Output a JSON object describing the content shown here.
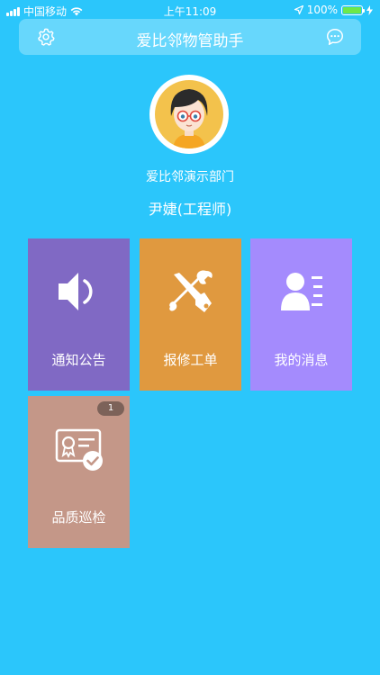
{
  "status_bar": {
    "carrier": "中国移动",
    "time": "上午11:09",
    "battery": "100%",
    "battery_level": 1.0,
    "battery_color": "#6ee84a"
  },
  "header": {
    "title": "爱比邻物管助手"
  },
  "profile": {
    "department": "爱比邻演示部门",
    "name": "尹婕(工程师)"
  },
  "tiles": [
    {
      "label": "通知公告",
      "icon": "speaker-icon",
      "color": "#8069c4"
    },
    {
      "label": "报修工单",
      "icon": "wrench-screwdriver-icon",
      "color": "#e0993f"
    },
    {
      "label": "我的消息",
      "icon": "contact-card-icon",
      "color": "#a48bfd"
    },
    {
      "label": "品质巡检",
      "icon": "certificate-check-icon",
      "color": "#c49788",
      "badge": "1"
    }
  ],
  "colors": {
    "background": "#2bc6fb",
    "navbar": "#67d7fc"
  }
}
